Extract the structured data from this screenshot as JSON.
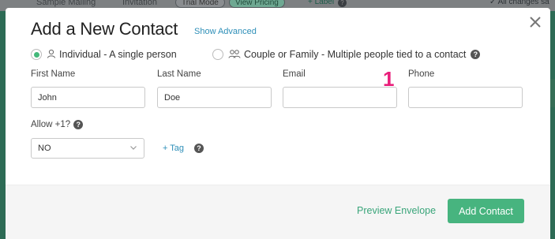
{
  "background": {
    "tabs": [
      "Sample Mailing",
      "Invitation"
    ],
    "pills": [
      "Trial Mode",
      "View Pricing"
    ],
    "label_link": "+ Label",
    "saved_status": "All changes sa"
  },
  "modal": {
    "title": "Add a New Contact",
    "show_advanced": "Show Advanced",
    "radio_individual": "Individual - A single person",
    "radio_couple": "Couple or Family - Multiple people tied to a contact",
    "fields": {
      "first_name_label": "First Name",
      "first_name_value": "John",
      "last_name_label": "Last Name",
      "last_name_value": "Doe",
      "email_label": "Email",
      "email_value": "",
      "phone_label": "Phone",
      "phone_value": ""
    },
    "allow_label": "Allow +1?",
    "allow_value": "NO",
    "tag_link": "+ Tag",
    "annotation": "1",
    "preview_envelope": "Preview Envelope",
    "add_contact": "Add Contact"
  },
  "colors": {
    "accent_green": "#47b47f",
    "link_blue": "#2e8fb8",
    "annotation_pink": "#e91e7a"
  }
}
